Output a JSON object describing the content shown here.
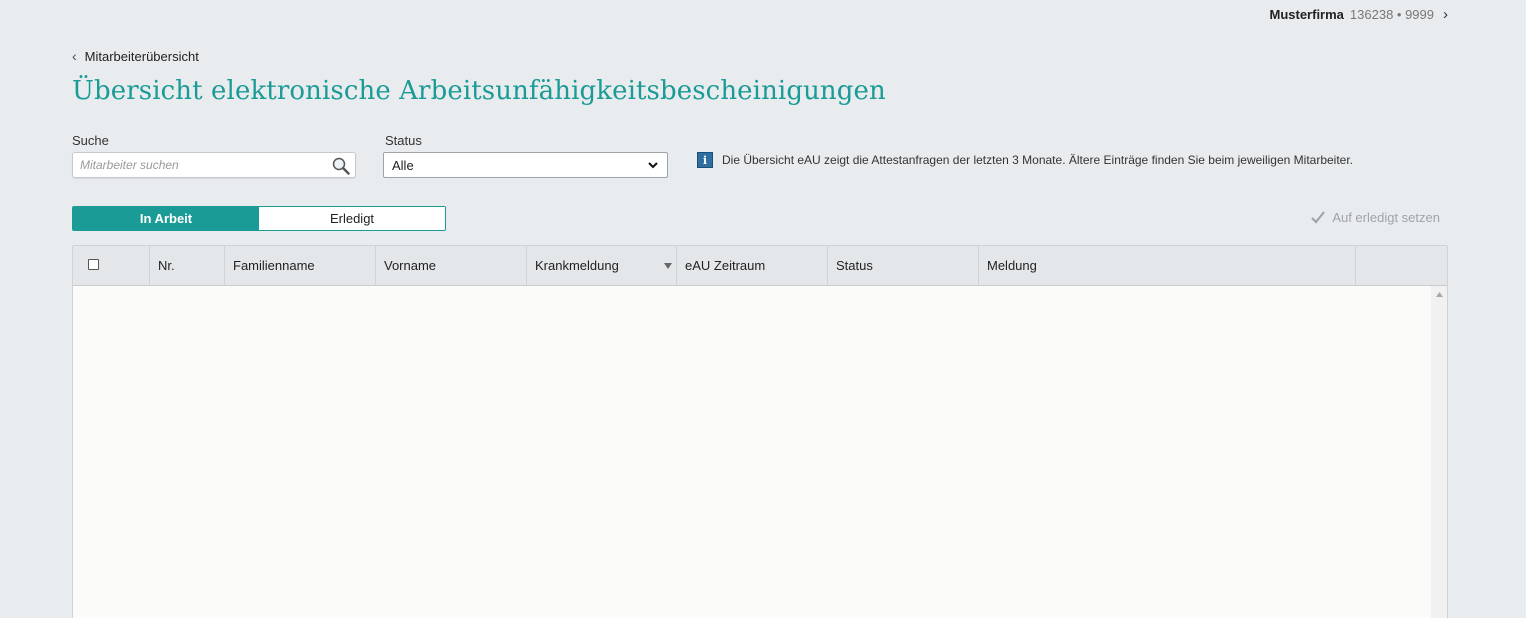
{
  "header": {
    "company_name": "Musterfirma",
    "company_meta": "136238 • 9999"
  },
  "breadcrumb": {
    "label": "Mitarbeiterübersicht"
  },
  "page": {
    "title": "Übersicht elektronische Arbeitsunfähigkeitsbescheinigungen"
  },
  "filters": {
    "search_label": "Suche",
    "search_placeholder": "Mitarbeiter suchen",
    "search_value": "",
    "status_label": "Status",
    "status_value": "Alle"
  },
  "info": {
    "text": "Die Übersicht eAU zeigt die Attestanfragen der letzten 3 Monate. Ältere Einträge finden Sie beim jeweiligen Mitarbeiter.",
    "icon": "info-icon"
  },
  "tabs": {
    "in_arbeit": "In Arbeit",
    "erledigt": "Erledigt",
    "active": "in_arbeit"
  },
  "actions": {
    "mark_done": "Auf erledigt setzen"
  },
  "table": {
    "columns": [
      "Nr.",
      "Familienname",
      "Vorname",
      "Krankmeldung",
      "eAU Zeitraum",
      "Status",
      "Meldung"
    ],
    "sorted_column": "Krankmeldung",
    "rows": []
  },
  "colors": {
    "accent": "#1a9b96",
    "background": "#e9ecef",
    "info_icon": "#2f6ea0"
  }
}
